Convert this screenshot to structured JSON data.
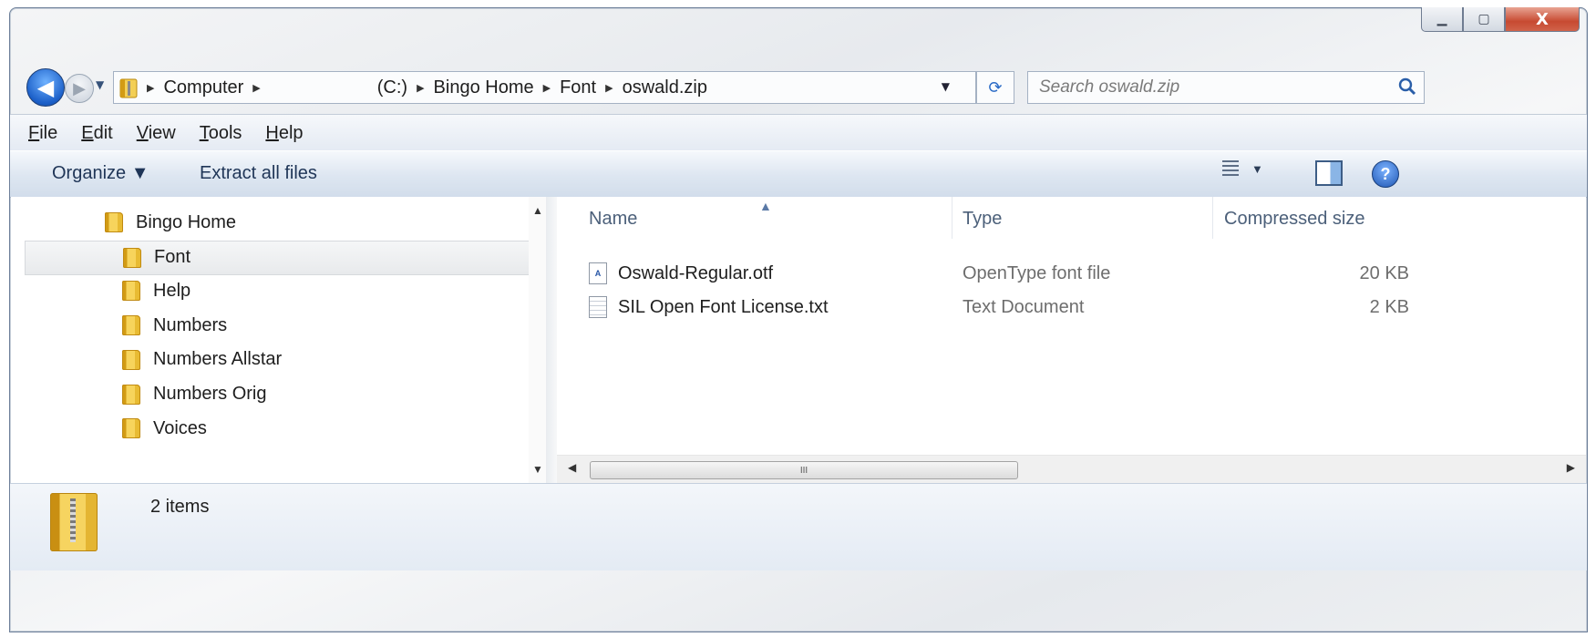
{
  "window": {
    "minimize_glyph": "▁",
    "maximize_glyph": "▢",
    "close_glyph": "X"
  },
  "navigation": {
    "back_glyph": "◀",
    "forward_glyph": "▶",
    "history_dropdown_glyph": "▼",
    "breadcrumbs": [
      "Computer",
      "(C:)",
      "Bingo Home",
      "Font",
      "oswald.zip"
    ],
    "separator_glyph": "▶",
    "address_dropdown_glyph": "▼",
    "refresh_glyph": "⟳"
  },
  "search": {
    "placeholder": "Search oswald.zip",
    "icon": "search-icon"
  },
  "menu": {
    "items": [
      {
        "accel": "F",
        "rest": "ile"
      },
      {
        "accel": "E",
        "rest": "dit"
      },
      {
        "accel": "V",
        "rest": "iew"
      },
      {
        "accel": "T",
        "rest": "ools"
      },
      {
        "accel": "H",
        "rest": "elp"
      }
    ]
  },
  "commands": {
    "organize": "Organize ▼",
    "extract": "Extract all files",
    "views_dropdown": "▼",
    "help": "?"
  },
  "tree": {
    "items": [
      {
        "label": "Bingo Home",
        "level": 0,
        "selected": false
      },
      {
        "label": "Font",
        "level": 1,
        "selected": true
      },
      {
        "label": "Help",
        "level": 1,
        "selected": false
      },
      {
        "label": "Numbers",
        "level": 1,
        "selected": false
      },
      {
        "label": "Numbers Allstar",
        "level": 1,
        "selected": false
      },
      {
        "label": "Numbers Orig",
        "level": 1,
        "selected": false
      },
      {
        "label": "Voices",
        "level": 1,
        "selected": false
      }
    ],
    "scroll_up_glyph": "▲",
    "scroll_down_glyph": "▼"
  },
  "files": {
    "columns": {
      "name": "Name",
      "type": "Type",
      "size": "Compressed size"
    },
    "sort_glyph": "▲",
    "rows": [
      {
        "name": "Oswald-Regular.otf",
        "type": "OpenType font file",
        "size": "20 KB",
        "icon": "otf-file-icon",
        "icon_glyph": "A"
      },
      {
        "name": "SIL Open Font License.txt",
        "type": "Text Document",
        "size": "2 KB",
        "icon": "text-file-icon",
        "icon_glyph": ""
      }
    ],
    "hscroll_left_glyph": "◀",
    "hscroll_right_glyph": "▶",
    "hscroll_grip": "III"
  },
  "status": {
    "item_count": "2 items"
  }
}
